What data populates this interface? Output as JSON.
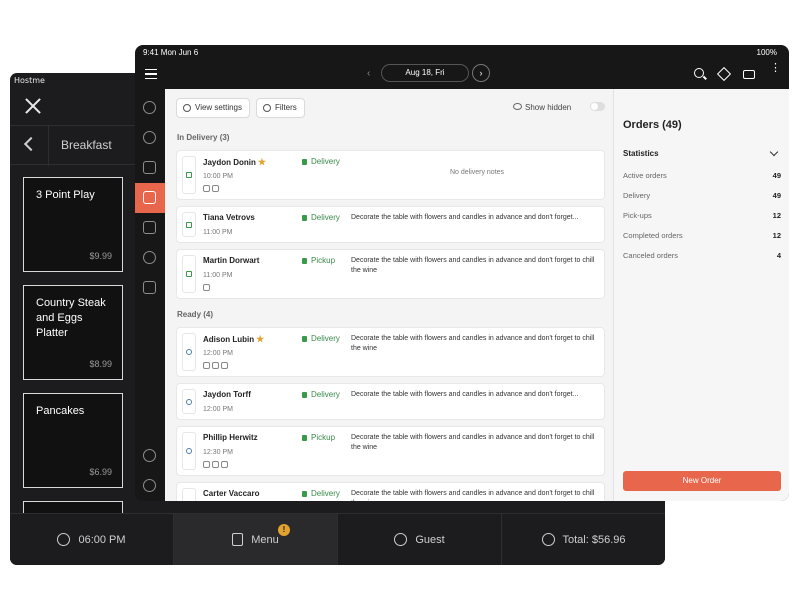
{
  "pos": {
    "status": "Hostme",
    "category": "Breakfast",
    "items": [
      {
        "name": "3 Point Play",
        "price": "$9.99"
      },
      {
        "name": "Country Steak and Eggs Platter",
        "price": "$8.99"
      },
      {
        "name": "Pancakes",
        "price": "$6.99"
      }
    ],
    "bottom": {
      "time": "06:00 PM",
      "menu": "Menu",
      "menu_badge": "!",
      "guest": "Guest",
      "total": "Total: $56.96"
    }
  },
  "tablet": {
    "status_time": "9:41 Mon Jun 6",
    "battery": "100%",
    "date": "Aug 18, Fri",
    "prev": "‹",
    "next": "›",
    "more": "⋮",
    "view_settings": "View settings",
    "filters": "Filters",
    "show_hidden": "Show hidden",
    "sections": {
      "delivery": "In Delivery (3)",
      "ready": "Ready (4)"
    },
    "orders": [
      {
        "name": "Jaydon Donin",
        "star": "★",
        "time": "10:00 PM",
        "type": "Delivery",
        "note": "No delivery notes"
      },
      {
        "name": "Tiana Vetrovs",
        "time": "11:00 PM",
        "type": "Delivery",
        "note": "Decorate the table with flowers and candles in advance and don't forget..."
      },
      {
        "name": "Martin Dorwart",
        "time": "11:00 PM",
        "type": "Pickup",
        "note": "Decorate the table with flowers and candles in advance and don't forget to chill the wine"
      },
      {
        "name": "Adison Lubin",
        "star": "★",
        "time": "12:00 PM",
        "type": "Delivery",
        "note": "Decorate the table with flowers and candles in advance and don't forget to chill the wine"
      },
      {
        "name": "Jaydon Torff",
        "time": "12:00 PM",
        "type": "Delivery",
        "note": "Decorate the table with flowers and candles in advance and don't forget..."
      },
      {
        "name": "Phillip Herwitz",
        "time": "12:30 PM",
        "type": "Pickup",
        "note": "Decorate the table with flowers and candles in advance and don't forget to chill the wine"
      },
      {
        "name": "Carter Vaccaro",
        "time": "",
        "type": "Delivery",
        "note": "Decorate the table with flowers and candles in advance and don't forget to chill the wine"
      }
    ],
    "right": {
      "title": "Orders (49)",
      "stats_title": "Statistics",
      "stats": [
        {
          "label": "Active orders",
          "value": "49"
        },
        {
          "label": "Delivery",
          "value": "49"
        },
        {
          "label": "Pick-ups",
          "value": "12"
        },
        {
          "label": "Completed orders",
          "value": "12"
        },
        {
          "label": "Canceled orders",
          "value": "4"
        }
      ],
      "new_order": "New Order"
    }
  },
  "colors": {
    "accent": "#e8674c",
    "star": "#e3a12f",
    "delivery": "#3a8a4a"
  }
}
